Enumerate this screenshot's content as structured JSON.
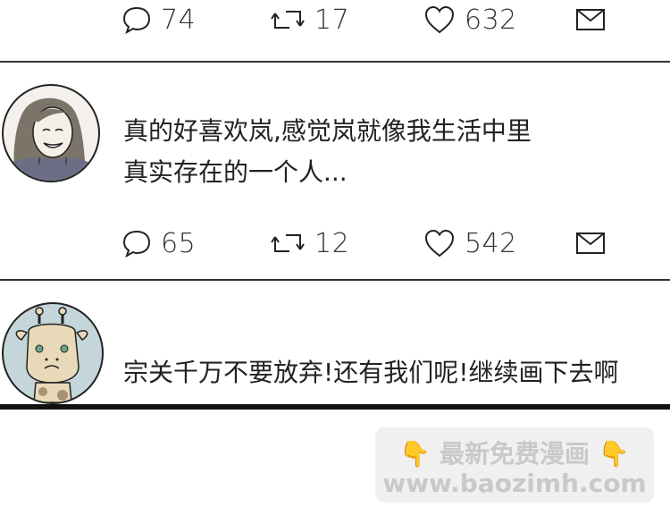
{
  "tweets": [
    {
      "actions": {
        "replies": "74",
        "retweets": "17",
        "likes": "632"
      }
    },
    {
      "text_line1": "真的好喜欢岚,感觉岚就像我生活中里",
      "text_line2": "真实存在的一个人...",
      "actions": {
        "replies": "65",
        "retweets": "12",
        "likes": "542"
      }
    },
    {
      "text_line1": "宗关千万不要放弃!还有我们呢!继续画下去啊"
    }
  ],
  "watermark": {
    "line1": "最新免费漫画",
    "line2": "www.baozimh.com",
    "hand": "👇"
  },
  "icons": [
    "reply-icon",
    "retweet-icon",
    "like-icon",
    "message-icon"
  ]
}
